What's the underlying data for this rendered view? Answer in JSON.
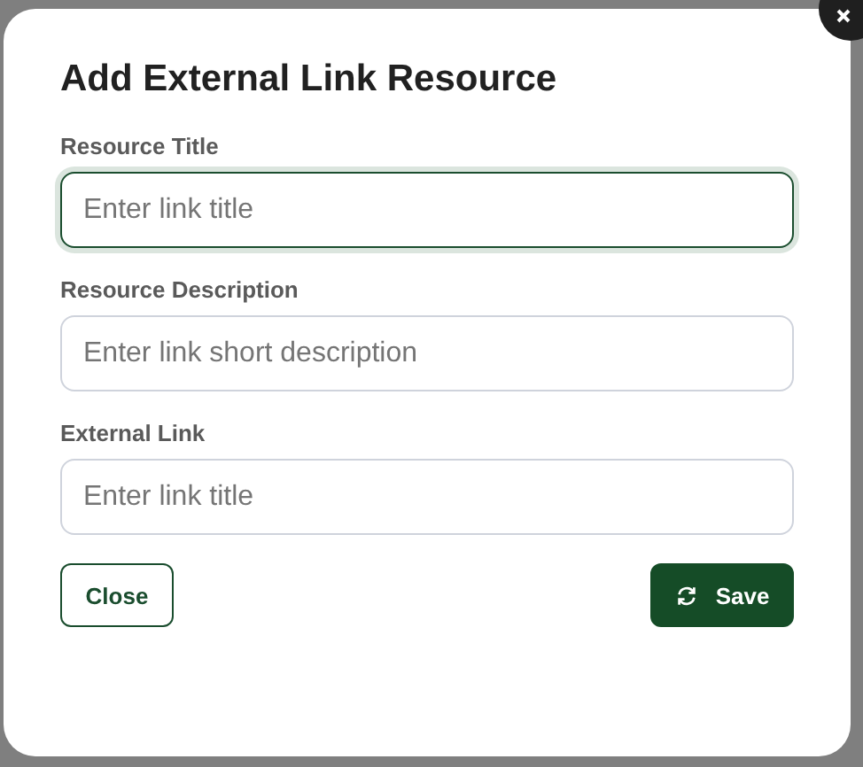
{
  "dialog": {
    "title": "Add External Link Resource",
    "fields": [
      {
        "label": "Resource Title",
        "placeholder": "Enter link title",
        "focused": true
      },
      {
        "label": "Resource Description",
        "placeholder": "Enter link short description",
        "focused": false
      },
      {
        "label": "External Link",
        "placeholder": "Enter link title",
        "focused": false
      }
    ],
    "buttons": [
      {
        "label": "Close",
        "kind": "secondary"
      },
      {
        "label": "Save",
        "kind": "primary"
      }
    ]
  }
}
